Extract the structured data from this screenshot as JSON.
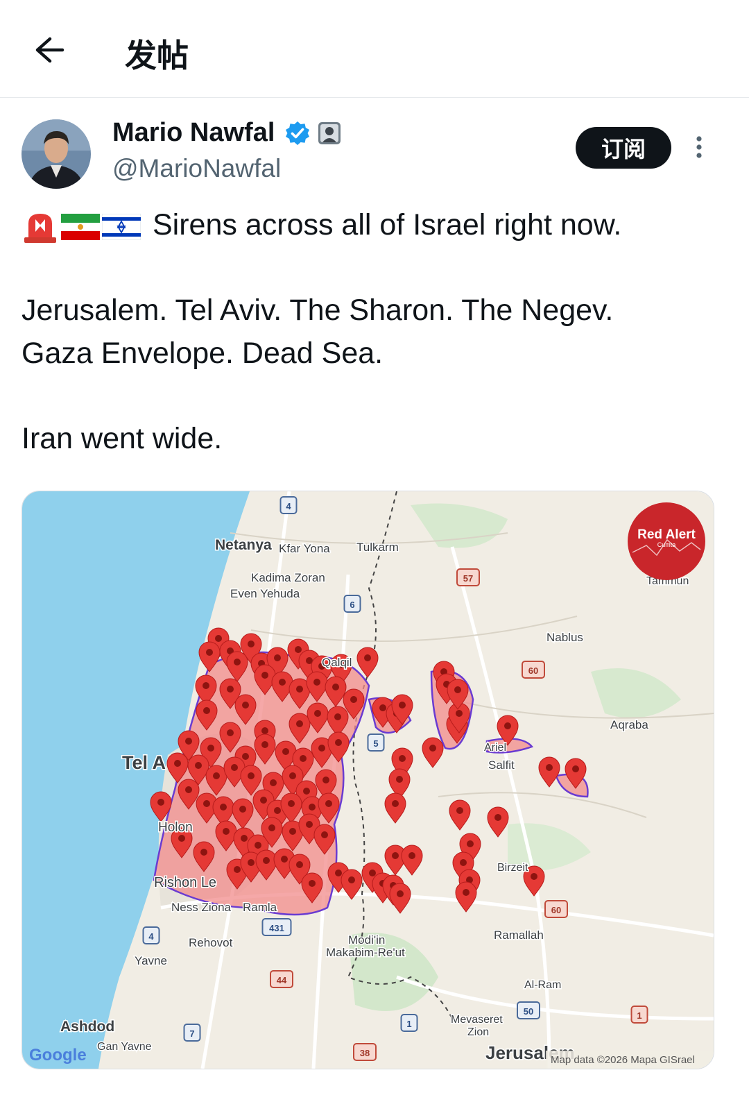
{
  "header": {
    "title": "发帖"
  },
  "post": {
    "author_name": "Mario Nawfal",
    "handle": "@MarioNawfal",
    "subscribe_label": "订阅",
    "line1": "Sirens across all of Israel right now.",
    "line2": "Jerusalem. Tel Aviv. The Sharon. The Negev.",
    "line3": "Gaza Envelope. Dead Sea.",
    "line4": "Iran went wide."
  },
  "map": {
    "labels": {
      "netanya": "Netanya",
      "kfar_yona": "Kfar Yona",
      "tulkarm": "Tulkarm",
      "kadima": "Kadima Zoran",
      "even_yehuda": "Even Yehuda",
      "nablus": "Nablus",
      "aqraba": "Aqraba",
      "qalqilya": "Qalqil",
      "tel_aviv": "Tel A",
      "holon": "Holon",
      "rishon": "Rishon Le",
      "ness_ziona": "Ness Ziona",
      "ramla": "Ramla",
      "rehovot": "Rehovot",
      "yavne": "Yavne",
      "ashdod": "Ashdod",
      "gan_yavne": "Gan Yavne",
      "salfit": "Salfit",
      "ariel": "Ariel",
      "birzeit": "Birzeit",
      "ramallah": "Ramallah",
      "al_ram": "Al-Ram",
      "modiin": "Modi'in",
      "makabim": "Makabim-Re'ut",
      "mevaseret": "Mevaseret",
      "zion": "Zion",
      "jerusalem": "Jerusalem",
      "tammun": "Tammun",
      "attribution": "Map data ©2026 Mapa GISrael",
      "google": "Google",
      "red_alert": "Red Alert",
      "red_alert_sub": "Cumta"
    },
    "roads": {
      "r4": "4",
      "r57": "57",
      "r6": "6",
      "r60a": "60",
      "r5": "5",
      "r4b": "4",
      "r431": "431",
      "r44": "44",
      "r7": "7",
      "r1a": "1",
      "r38": "38",
      "r50": "50",
      "r60b": "60",
      "r1b": "1"
    },
    "colors": {
      "water": "#8fd0ec",
      "land": "#f1ede4",
      "alert": "#e53935",
      "zone": "#f28b8b",
      "zone_border": "#6a3bd1"
    }
  }
}
